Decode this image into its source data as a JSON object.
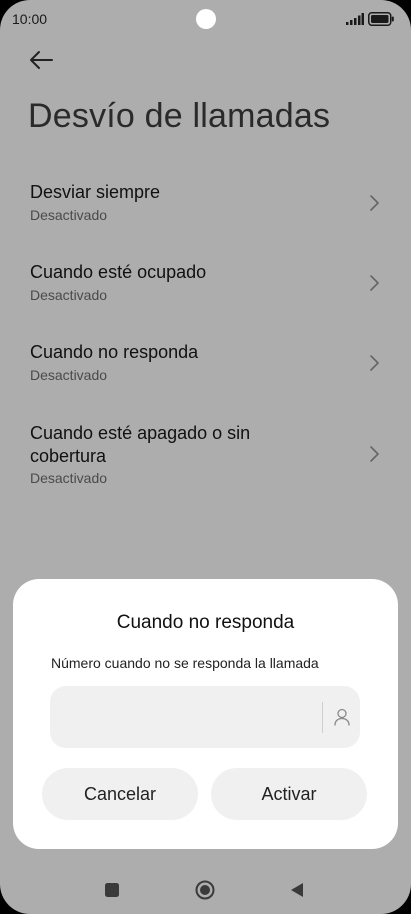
{
  "status_bar": {
    "time": "10:00"
  },
  "header": {
    "back_icon": "arrow-left-icon",
    "title": "Desvío de llamadas"
  },
  "settings": {
    "items": [
      {
        "title": "Desviar siempre",
        "subtitle": "Desactivado"
      },
      {
        "title": "Cuando esté ocupado",
        "subtitle": "Desactivado"
      },
      {
        "title": "Cuando no responda",
        "subtitle": "Desactivado"
      },
      {
        "title": "Cuando esté apagado o sin cobertura",
        "subtitle": "Desactivado"
      }
    ]
  },
  "dialog": {
    "title": "Cuando no responda",
    "field_label": "Número cuando no se responda la llamada",
    "field_value": "",
    "contact_icon": "person-icon",
    "cancel_label": "Cancelar",
    "activate_label": "Activar"
  },
  "nav_bar": {
    "recents_icon": "square-icon",
    "home_icon": "circle-icon",
    "back_icon": "triangle-back-icon"
  },
  "colors": {
    "scrim_background": "#adadad",
    "dialog_background": "#ffffff",
    "button_background": "#f0f0f0",
    "text_primary": "#111111"
  }
}
